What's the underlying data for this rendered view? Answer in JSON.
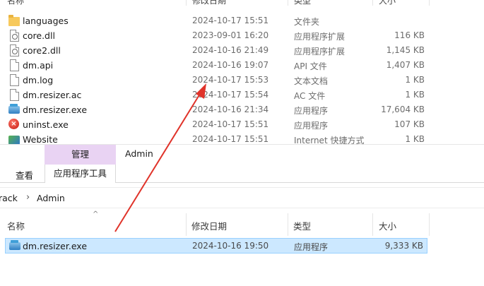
{
  "top_list": {
    "headers": {
      "name": "名称",
      "date": "修改日期",
      "type": "类型",
      "size": "大小"
    },
    "rows": [
      {
        "name": "languages",
        "date": "2024-10-17 15:51",
        "type": "文件夹",
        "size": "",
        "icon": "folder-icon"
      },
      {
        "name": "core.dll",
        "date": "2023-09-01 16:20",
        "type": "应用程序扩展",
        "size": "116 KB",
        "icon": "dll-file-icon"
      },
      {
        "name": "core2.dll",
        "date": "2024-10-16 21:49",
        "type": "应用程序扩展",
        "size": "1,145 KB",
        "icon": "dll-file-icon"
      },
      {
        "name": "dm.api",
        "date": "2024-10-16 19:07",
        "type": "API 文件",
        "size": "1,407 KB",
        "icon": "file-icon"
      },
      {
        "name": "dm.log",
        "date": "2024-10-17 15:53",
        "type": "文本文档",
        "size": "1 KB",
        "icon": "file-icon"
      },
      {
        "name": "dm.resizer.ac",
        "date": "2024-10-17 15:54",
        "type": "AC 文件",
        "size": "1 KB",
        "icon": "file-icon"
      },
      {
        "name": "dm.resizer.exe",
        "date": "2024-10-16 21:34",
        "type": "应用程序",
        "size": "17,604 KB",
        "icon": "exe-icon"
      },
      {
        "name": "uninst.exe",
        "date": "2024-10-17 15:51",
        "type": "应用程序",
        "size": "107 KB",
        "icon": "uninstall-icon"
      },
      {
        "name": "Website",
        "date": "2024-10-17 15:51",
        "type": "Internet 快捷方式",
        "size": "1 KB",
        "icon": "web-shortcut-icon"
      }
    ]
  },
  "ribbon": {
    "manage_tab": "管理",
    "window_title": "Admin",
    "view_tab": "查看",
    "app_tools_tab": "应用程序工具"
  },
  "address_bar": {
    "crumbs": [
      "rack",
      "Admin"
    ]
  },
  "bottom_list": {
    "headers": {
      "name": "名称",
      "date": "修改日期",
      "type": "类型",
      "size": "大小"
    },
    "sort_indicator": "^",
    "rows": [
      {
        "name": "dm.resizer.exe",
        "date": "2024-10-16 19:50",
        "type": "应用程序",
        "size": "9,333 KB",
        "icon": "exe-icon",
        "selected": true
      }
    ]
  },
  "colors": {
    "selection_bg": "#cce8ff",
    "selection_border": "#99d1ff",
    "manage_tab_bg": "#e9d3f3",
    "arrow": "#e0332a"
  }
}
